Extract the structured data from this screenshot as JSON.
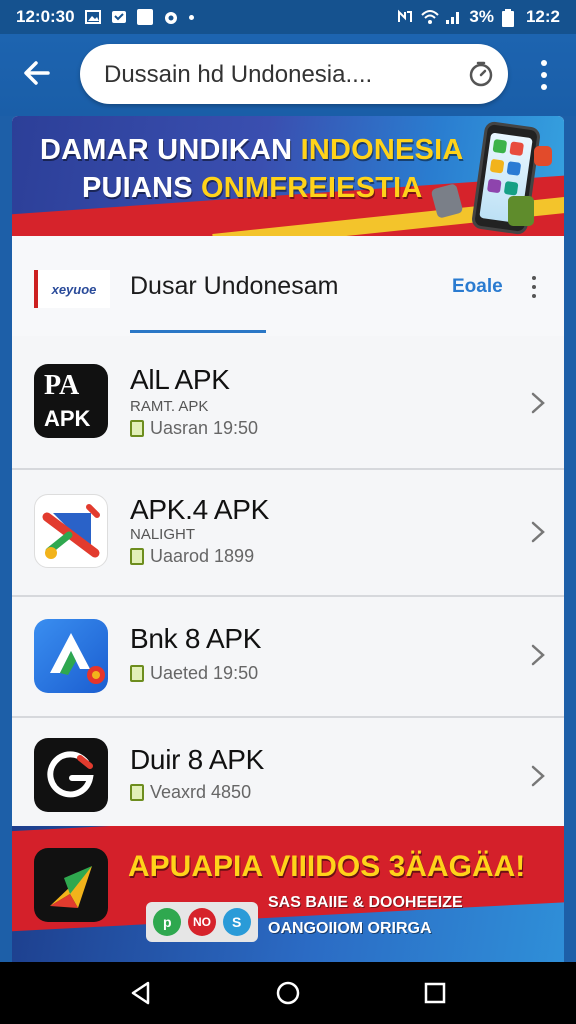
{
  "status_bar": {
    "time": "12:0:30",
    "battery_text": "3%",
    "clock_right": "12:2"
  },
  "search": {
    "value": "Dussain hd  Undonesia...."
  },
  "hero": {
    "line1_white": "DAMAR UNDIKAN ",
    "line1_gold": "INDONESIA",
    "line2_white": "PUIANS ",
    "line2_gold": "ONMFREIESTIA"
  },
  "section": {
    "logo_text": "xeyuoe",
    "title": "Dusar Undonesam",
    "link": "Eoale"
  },
  "apps": [
    {
      "name": "AlL APK",
      "sub": "RAMT. APK",
      "meta": "Uasran 19:50"
    },
    {
      "name": "APK.4 APK",
      "sub": "NALIGHT",
      "meta": "Uaarod 1899"
    },
    {
      "name": "Bnk 8 APK",
      "sub": "",
      "meta": "Uaeted 19:50"
    },
    {
      "name": "Duir 8 APK",
      "sub": "",
      "meta": "Veaxrd 4850"
    }
  ],
  "icon_texts": {
    "apk_logo_top": "PA",
    "apk_logo_bottom": "APK"
  },
  "promo": {
    "title": "APUAPIA VIIIDOS 3ÄAGÄA!",
    "line1": "SAS BAIIE & DOOHEEIZE",
    "line2": "OANGOIIOM ORIRGA",
    "badges": [
      "p",
      "NO",
      "S"
    ]
  },
  "colors": {
    "top_bar": "#1d64b0",
    "accent_blue": "#2a7bd0",
    "gold": "#ffd31a",
    "red": "#d6232b"
  }
}
